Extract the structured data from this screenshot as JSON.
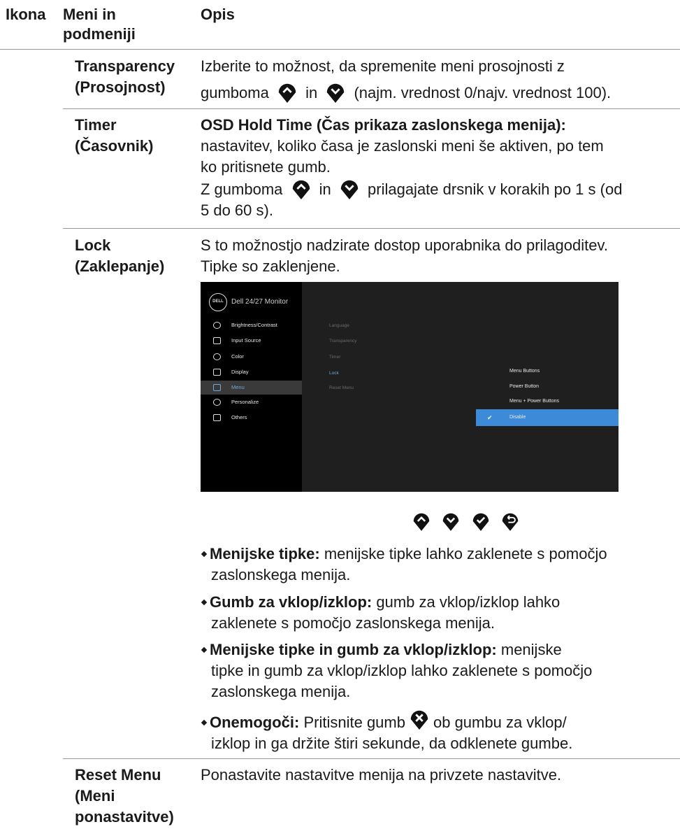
{
  "header": {
    "col1": "Ikona",
    "col2_line1": "Meni in",
    "col2_line2": "podmeniji",
    "col3": "Opis"
  },
  "rows": {
    "transparency": {
      "name_line1": "Transparency",
      "name_line2": "(Prosojnost)",
      "text_line1": "Izberite to možnost, da spremenite meni prosojnosti z",
      "text_a": "gumboma",
      "text_b": "in",
      "text_c": "(najm. vrednost 0/najv. vrednost 100)."
    },
    "timer": {
      "name_line1": "Timer",
      "name_line2": "(Časovnik)",
      "bold": "OSD Hold Time (Čas prikaza zaslonskega menija):",
      "line2": "nastavitev, koliko časa je zaslonski meni še aktiven, po tem",
      "line3": "ko pritisnete gumb.",
      "line4_a": "Z gumboma",
      "line4_b": "in",
      "line4_c": "prilagajate drsnik v korakih po 1 s (od",
      "line5": "5 do 60 s)."
    },
    "lock": {
      "name_line1": "Lock",
      "name_line2": "(Zaklepanje)",
      "line1": "S to možnostjo nadzirate dostop uporabnika do prilagoditev.",
      "line2": "Tipke so zaklenjene.",
      "bullets": [
        {
          "bold": "Menijske tipke:",
          "rest1": "menijske tipke lahko zaklenete s pomočjo",
          "rest2": "zaslonskega menija."
        },
        {
          "bold": "Gumb za vklop/izklop:",
          "rest1": "gumb za vklop/izklop lahko",
          "rest2": "zaklenete s pomočjo zaslonskega menija."
        },
        {
          "bold": "Menijske tipke in gumb za vklop/izklop:",
          "rest1": "menijske",
          "rest2": "tipke in gumb za vklop/izklop lahko zaklenete s pomočjo",
          "rest3": "zaslonskega menija."
        },
        {
          "bold": "Onemogoči:",
          "rest1a": "Pritisnite gumb",
          "rest1b": "ob gumbu za vklop/",
          "rest2": "izklop in ga držite štiri sekunde, da odklenete gumbe."
        }
      ]
    },
    "reset": {
      "name_line1": "Reset Menu",
      "name_line2": "(Meni",
      "name_line3": "ponastavitve)",
      "text": "Ponastavite nastavitve menija na privzete nastavitve."
    }
  },
  "osd": {
    "logo": "DELL",
    "title": "Dell 24/27 Monitor",
    "menu": [
      "Brightness/Contrast",
      "Input Source",
      "Color",
      "Display",
      "Menu",
      "Personalize",
      "Others"
    ],
    "selected_menu": "Menu",
    "submenu": [
      "Language",
      "Transparency",
      "Timer",
      "Lock",
      "Reset Menu"
    ],
    "active_submenu": "Lock",
    "options": [
      "Menu Buttons",
      "Power Button",
      "Menu + Power Buttons",
      "Disable"
    ],
    "selected_option": "Disable",
    "accent": "#3c8ad8"
  },
  "nav_buttons": [
    "up-icon",
    "down-icon",
    "check-icon",
    "back-icon"
  ]
}
